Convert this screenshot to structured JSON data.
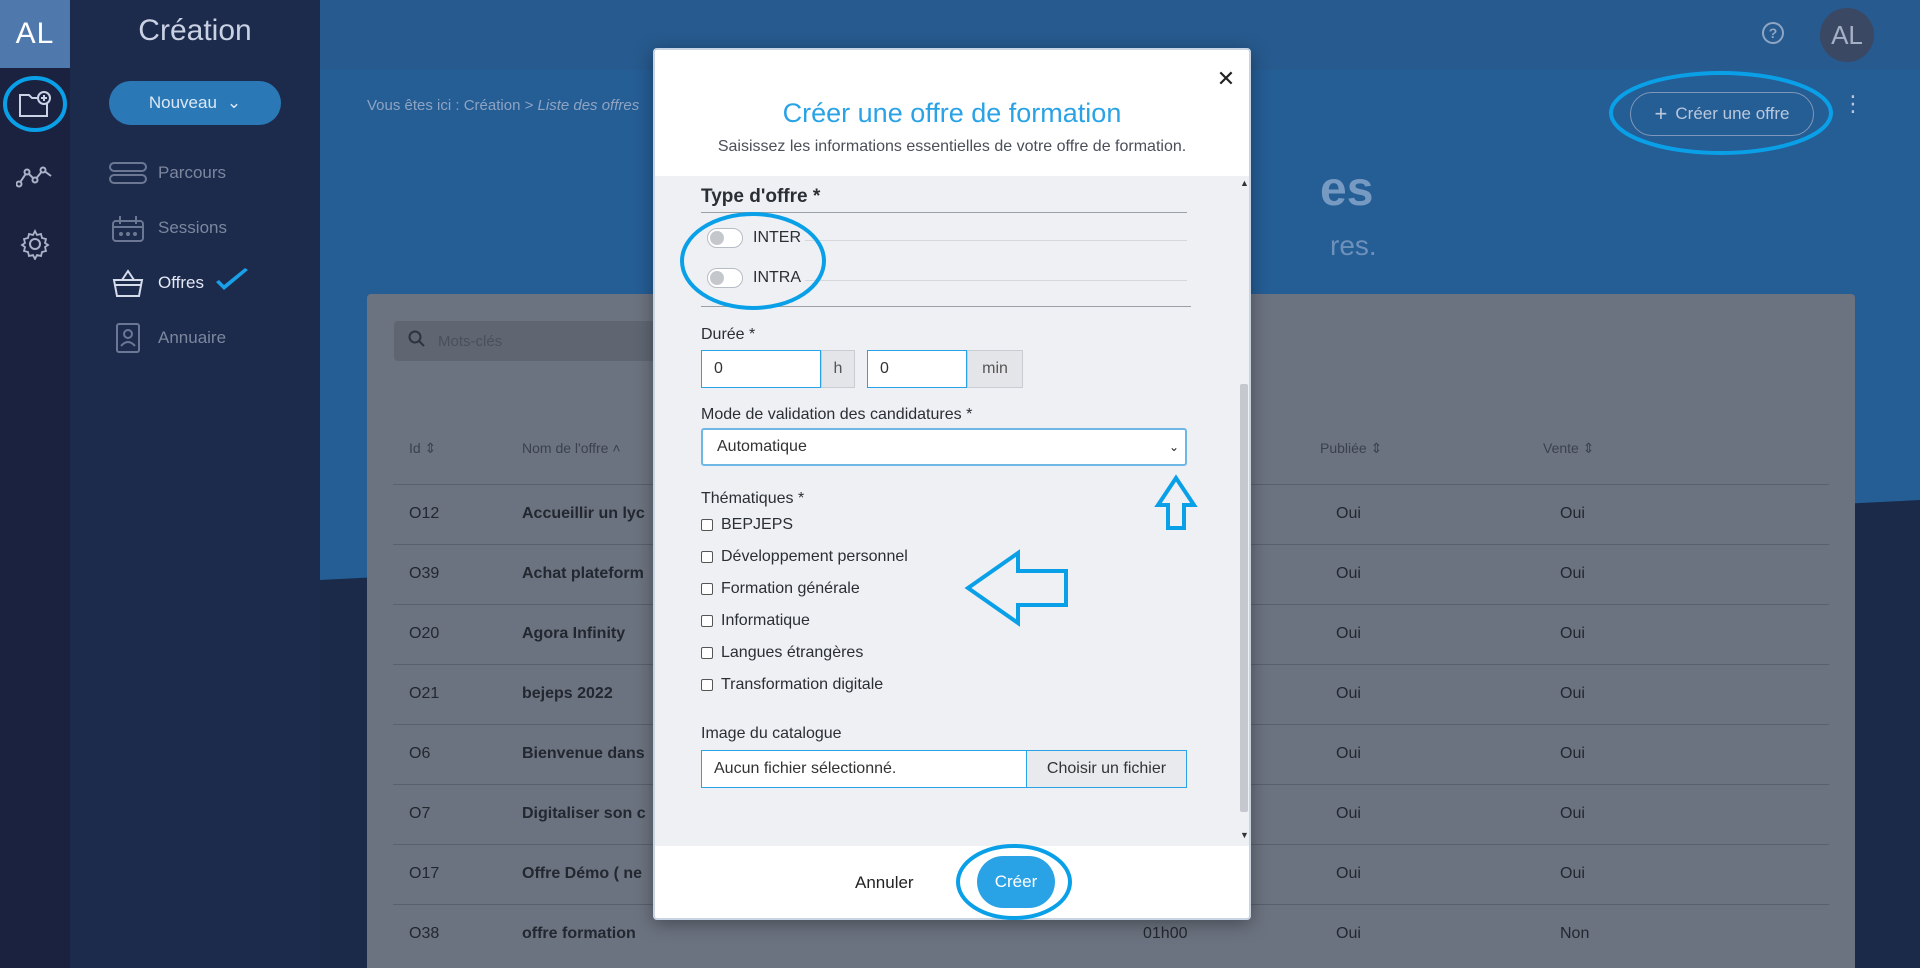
{
  "rail": {
    "logo": "AL"
  },
  "panel": {
    "title": "Création",
    "new_button": "Nouveau",
    "items": [
      {
        "label": "Parcours"
      },
      {
        "label": "Sessions"
      },
      {
        "label": "Offres"
      },
      {
        "label": "Annuaire"
      }
    ]
  },
  "header": {
    "avatar": "AL",
    "help": "?"
  },
  "breadcrumb": {
    "prefix": "Vous êtes ici : Création > ",
    "current": "Liste des offres"
  },
  "page": {
    "create_button": "Créer une offre",
    "title_fragment": "es",
    "subtitle_fragment": "res."
  },
  "search": {
    "placeholder": "Mots-clés"
  },
  "table": {
    "headers": {
      "id": "Id",
      "name": "Nom de l'offre",
      "published": "Publiée",
      "sale": "Vente"
    },
    "rows": [
      {
        "id": "O12",
        "name": "Accueillir un lyc",
        "duration": "",
        "published": "Oui",
        "sale": "Oui"
      },
      {
        "id": "O39",
        "name": "Achat plateform",
        "duration": "",
        "published": "Oui",
        "sale": "Oui"
      },
      {
        "id": "O20",
        "name": "Agora Infinity",
        "duration": "",
        "published": "Oui",
        "sale": "Oui"
      },
      {
        "id": "O21",
        "name": "bejeps 2022",
        "duration": "",
        "published": "Oui",
        "sale": "Oui"
      },
      {
        "id": "O6",
        "name": "Bienvenue dans",
        "duration": "",
        "published": "Oui",
        "sale": "Oui"
      },
      {
        "id": "O7",
        "name": "Digitaliser son c",
        "duration": "",
        "published": "Oui",
        "sale": "Oui"
      },
      {
        "id": "O17",
        "name": "Offre Démo ( ne",
        "duration": "",
        "published": "Oui",
        "sale": "Oui"
      },
      {
        "id": "O38",
        "name": "offre formation",
        "duration": "01h00",
        "published": "Oui",
        "sale": "Non"
      }
    ]
  },
  "modal": {
    "title": "Créer une offre de formation",
    "subtitle": "Saisissez les informations essentielles de votre offre de formation.",
    "type_section": "Type d'offre *",
    "type_options": [
      "INTER",
      "INTRA"
    ],
    "duration_label": "Durée *",
    "hours_value": "0",
    "hours_unit": "h",
    "minutes_value": "0",
    "minutes_unit": "min",
    "validation_label": "Mode de validation des candidatures *",
    "validation_value": "Automatique",
    "themes_label": "Thématiques *",
    "themes": [
      "BEPJEPS",
      "Développement personnel",
      "Formation générale",
      "Informatique",
      "Langues étrangères",
      "Transformation digitale"
    ],
    "image_label": "Image du catalogue",
    "file_placeholder": "Aucun fichier sélectionné.",
    "file_button": "Choisir un fichier",
    "cancel": "Annuler",
    "create": "Créer"
  },
  "colors": {
    "accent": "#2aa3e6",
    "annotation": "#0aa0e8"
  }
}
